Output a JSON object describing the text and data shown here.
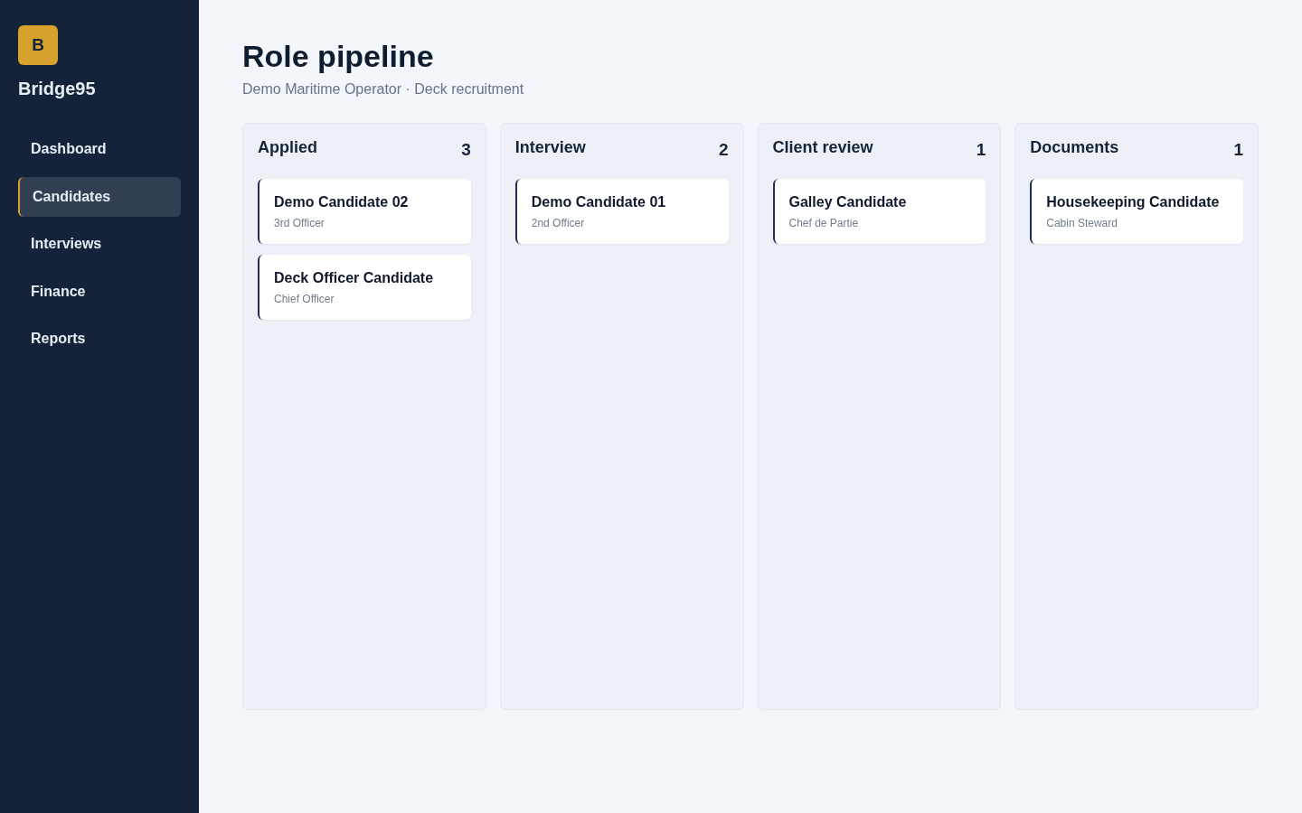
{
  "sidebar": {
    "logo": "B",
    "brand": "Bridge95",
    "items": [
      {
        "label": "Dashboard",
        "selected": false
      },
      {
        "label": "Candidates",
        "selected": true
      },
      {
        "label": "Interviews",
        "selected": false
      },
      {
        "label": "Finance",
        "selected": false
      },
      {
        "label": "Reports",
        "selected": false
      }
    ]
  },
  "header": {
    "title": "Role pipeline",
    "subtitle": "Demo Maritime Operator · Deck recruitment"
  },
  "columns": [
    {
      "title": "Applied",
      "count": "3",
      "cards": [
        {
          "name": "Demo Candidate 02",
          "role": "3rd Officer"
        },
        {
          "name": "Deck Officer Candidate",
          "role": "Chief Officer"
        }
      ]
    },
    {
      "title": "Interview",
      "count": "2",
      "cards": [
        {
          "name": "Demo Candidate 01",
          "role": "2nd Officer"
        }
      ]
    },
    {
      "title": "Client review",
      "count": "1",
      "cards": [
        {
          "name": "Galley Candidate",
          "role": "Chef de Partie"
        }
      ]
    },
    {
      "title": "Documents",
      "count": "1",
      "cards": [
        {
          "name": "Housekeeping Candidate",
          "role": "Cabin Steward"
        }
      ]
    }
  ]
}
